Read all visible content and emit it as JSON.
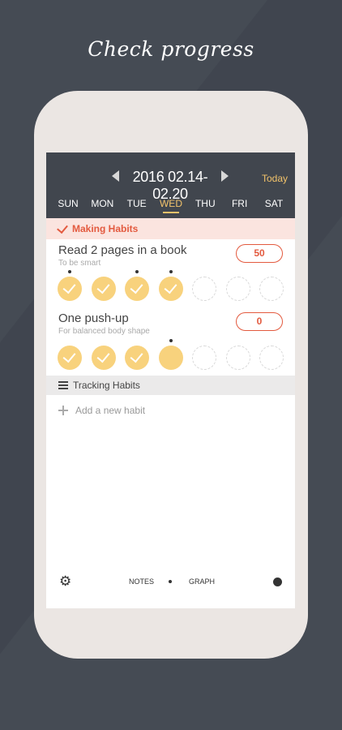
{
  "headline": "Check progress",
  "header": {
    "date_range": "2016 02.14-02.20",
    "today_label": "Today",
    "days": [
      "SUN",
      "MON",
      "TUE",
      "WED",
      "THU",
      "FRI",
      "SAT"
    ],
    "active_day": "WED"
  },
  "making_section": {
    "label": "Making Habits"
  },
  "habits": [
    {
      "name": "Read 2 pages in a book",
      "subtitle": "To be smart",
      "count": "50",
      "checks": [
        "done",
        "done",
        "done",
        "done",
        "open",
        "open",
        "open"
      ],
      "dots": [
        0,
        2,
        3
      ]
    },
    {
      "name": "One push-up",
      "subtitle": "For balanced body shape",
      "count": "0",
      "checks": [
        "done",
        "done",
        "done",
        "filled",
        "open",
        "open",
        "open"
      ],
      "dots": [
        3
      ]
    }
  ],
  "tracking_section": {
    "label": "Tracking Habits"
  },
  "add_habit": {
    "label": "Add a new habit"
  },
  "bottom_bar": {
    "notes_label": "NOTES",
    "graph_label": "GRAPH"
  },
  "colors": {
    "accent_red": "#e35a3f",
    "accent_yellow": "#f8d27d",
    "topbar": "#41464e",
    "background": "#454b54"
  },
  "icons": [
    "chevron-left-icon",
    "chevron-right-icon",
    "check-icon",
    "hamburger-icon",
    "plus-icon",
    "gear-icon",
    "profile-icon"
  ]
}
